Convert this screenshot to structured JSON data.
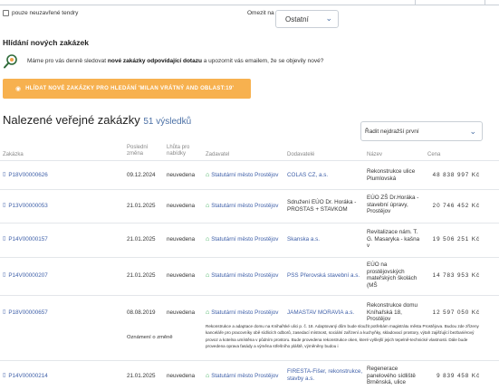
{
  "filters": {
    "unfinished_only": "pouze neuzavřené tendry",
    "order_label": "Omezit na",
    "order_value": "Ostatní"
  },
  "watch": {
    "heading": "Hlídání nových zakázek",
    "text_before": "Máme pro vás denně sledovat ",
    "text_bold": "nové zakázky odpovídající dotazu",
    "text_after": " a upozornit vás emailem, že se objevily nové?",
    "button_label": "HLÍDAT NOVÉ ZAKÁZKY PRO HLEDÁNÍ 'MILAN VRÁTNÝ AND OBLAST:19'"
  },
  "results": {
    "title": "Nalezené veřejné zakázky",
    "count": "51 výsledků",
    "sort_value": "Řadit nejdražší první"
  },
  "table": {
    "headers": {
      "code": "Zakázka",
      "changed": "Poslední\nzměna",
      "deadline": "Lhůta pro\nnabídky",
      "owner": "Zadavatel",
      "supplier": "Dodavatelé",
      "name": "Název",
      "price": "Cena"
    },
    "rows": [
      {
        "code": "P18V00000626",
        "changed": "09.12.2024",
        "deadline": "neuvedena",
        "owner": "Statutární město Prostějov",
        "supplier": "COLAS CZ, a.s.",
        "name": "Rekonstrukce ulice Plumlovská",
        "price": "48 838 997 Kč"
      },
      {
        "code": "P13V00000053",
        "changed": "21.01.2025",
        "deadline": "neuvedena",
        "owner": "Statutární město Prostějov",
        "supplier": "Sdružení EÚO Dr. Horáka - PROSTAS + STAVKOM",
        "name": "EÚO ZŠ Dr.Horáka - stavební úpravy, Prostějov",
        "price": "20 746 452 Kč"
      },
      {
        "code": "P14V00000157",
        "changed": "21.01.2025",
        "deadline": "neuvedena",
        "owner": "Statutární město Prostějov",
        "supplier": "Skanska a.s.",
        "name": "Revitalizace nám. T. G. Masaryka - kašna v",
        "price": "19 506 251 Kč"
      },
      {
        "code": "P14V00000207",
        "changed": "21.01.2025",
        "deadline": "neuvedena",
        "owner": "Statutární město Prostějov",
        "supplier": "PSS Přerovská stavební a.s.",
        "name": "EÚO na prostějovských mateřských školách (MŠ",
        "price": "14 783 953 Kč"
      },
      {
        "code": "P18V00000657",
        "changed": "08.08.2019",
        "deadline": "neuvedena",
        "owner": "Statutární město Prostějov",
        "supplier": "JAMASTAV MORAVIA a.s.",
        "name": "Rekonstrukce domu Kníhařská 18, Prostějov",
        "price": "12 597 050 Kč"
      },
      {
        "code": "P14V00000214",
        "changed": "21.01.2025",
        "deadline": "neuvedena",
        "owner": "Statutární město Prostějov",
        "supplier": "FIRESTA-Fišer, rekonstrukce, stavby a.s.",
        "name": "Regenerace panelového sídliště Brněnská, ulice",
        "price": "9 839 458 Kč"
      }
    ],
    "change_notice": "Oznámení o změně",
    "description": "Rekonstrukce a adaptace domu na Knihařské ulici p. č. 18. Adaptovaný dům bude sloužit potřebám magistrátu města Prostějova. Budou zde zřízeny kanceláře pro pracovníky obě sídlicích odborů, zasedací místnost, sociální zařízení a kuchyňky, skladovací prostory, výtah zajišťující bezbariérový provoz a kotelna umístěna v půdním prostoru. Bude provedena rekonstrukce oken, které vyšlejší jejich tepelně-technické vlastnosti. Dále bude provedena oprava fasády a výměna střešního pláště, výměněny budou i"
  }
}
